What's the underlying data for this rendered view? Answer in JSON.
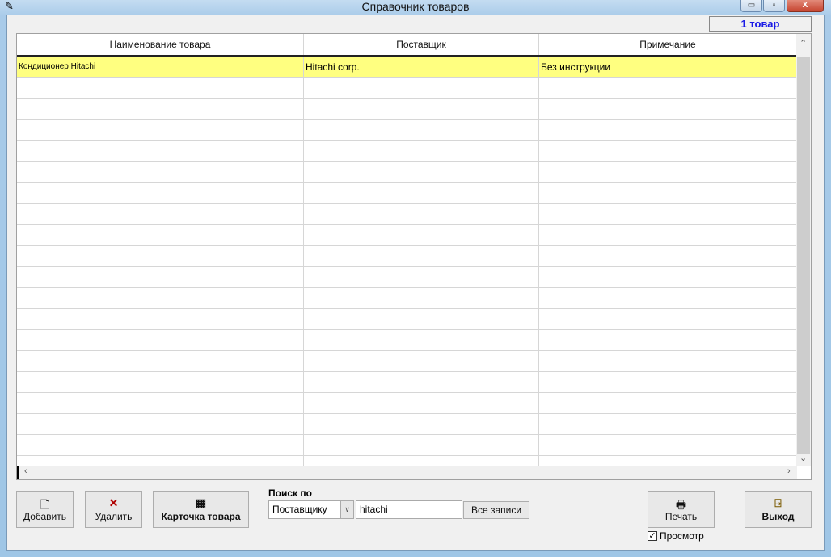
{
  "window": {
    "title": "Справочник товаров",
    "minimize": "▭",
    "maximize": "▫",
    "close": "X"
  },
  "count_label": "1 товар",
  "table": {
    "columns": [
      "Наименование товара",
      "Поставщик",
      "Примечание"
    ],
    "rows": [
      [
        "Кондиционер Hitachi",
        "Hitachi corp.",
        "Без инструкции"
      ]
    ]
  },
  "toolbar": {
    "add": "Добавить",
    "delete": "Удалить",
    "card": "Карточка товара",
    "print": "Печать",
    "exit": "Выход",
    "preview": "Просмотр",
    "preview_checked": true
  },
  "search": {
    "label": "Поиск по",
    "field": "Поставщику",
    "value": "hitachi",
    "all_records": "Все записи"
  }
}
